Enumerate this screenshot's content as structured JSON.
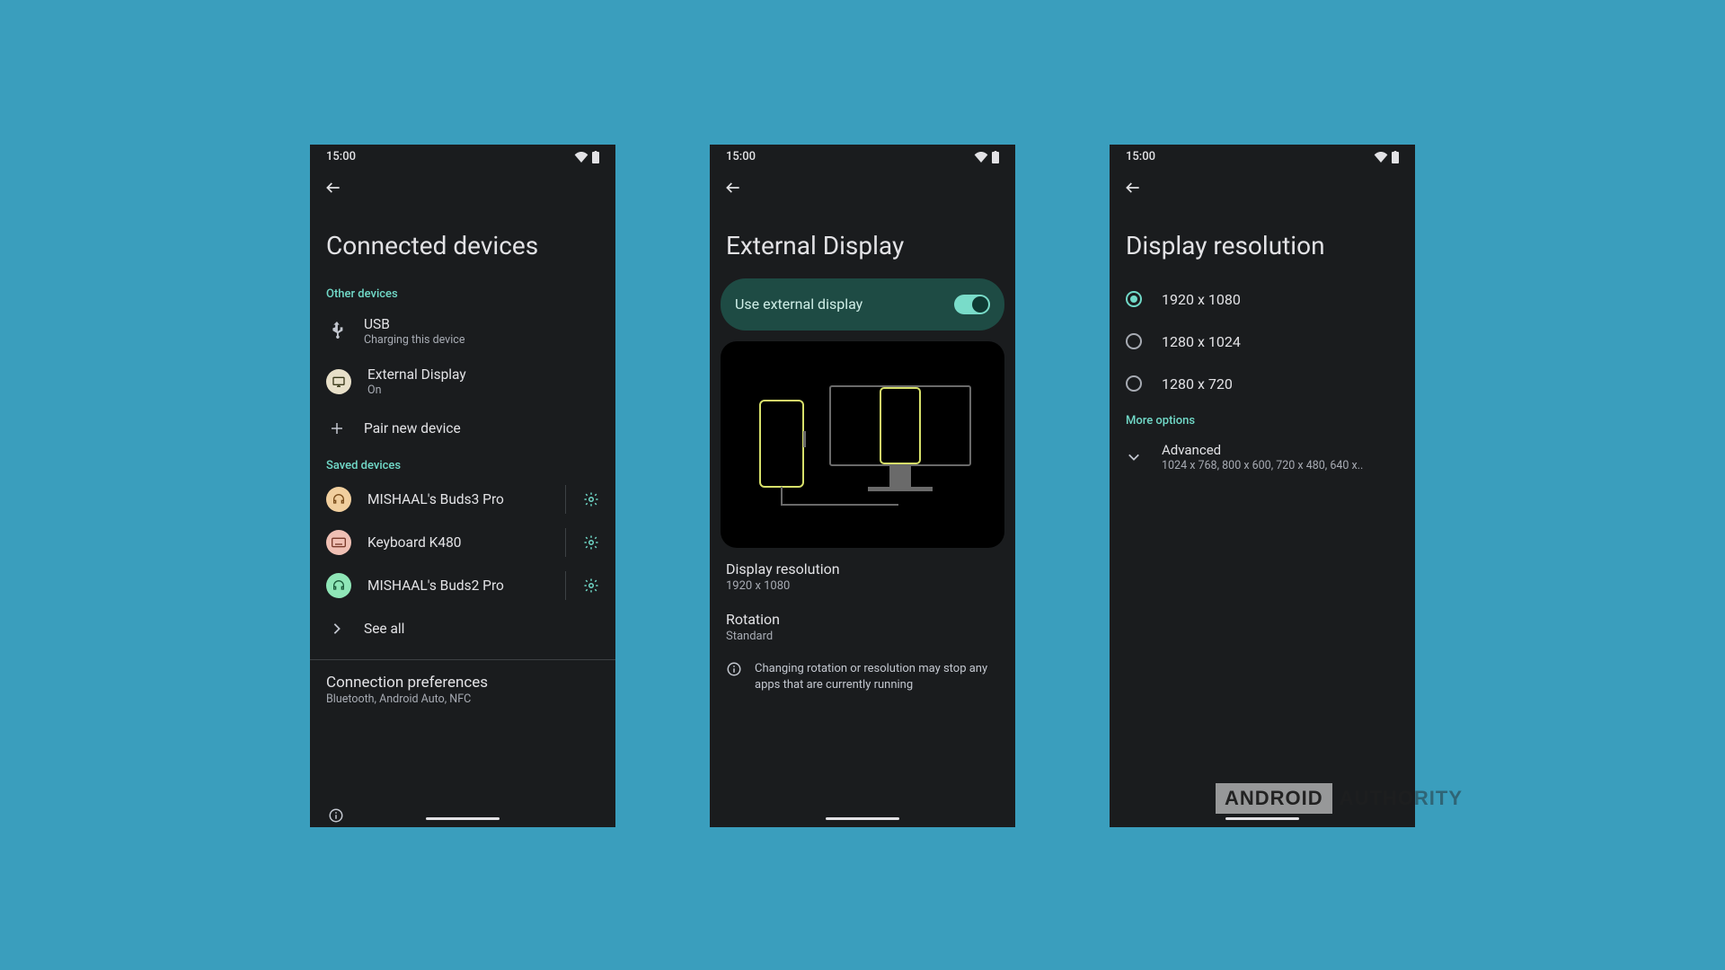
{
  "status": {
    "time": "15:00"
  },
  "screen1": {
    "title": "Connected devices",
    "section_other": "Other devices",
    "usb": {
      "title": "USB",
      "sub": "Charging this device"
    },
    "external": {
      "title": "External Display",
      "sub": "On"
    },
    "pair": "Pair new device",
    "section_saved": "Saved devices",
    "saved": [
      {
        "name": "MISHAAL's Buds3 Pro"
      },
      {
        "name": "Keyboard K480"
      },
      {
        "name": "MISHAAL's Buds2 Pro"
      }
    ],
    "see_all": "See all",
    "con_pref": {
      "title": "Connection preferences",
      "sub": "Bluetooth, Android Auto, NFC"
    }
  },
  "screen2": {
    "title": "External Display",
    "toggle_label": "Use external display",
    "toggle_on": true,
    "resolution": {
      "title": "Display resolution",
      "value": "1920 x 1080"
    },
    "rotation": {
      "title": "Rotation",
      "value": "Standard"
    },
    "info": "Changing rotation or resolution may stop any apps that are currently running"
  },
  "screen3": {
    "title": "Display resolution",
    "options": [
      {
        "label": "1920 x 1080",
        "selected": true
      },
      {
        "label": "1280 x 1024",
        "selected": false
      },
      {
        "label": "1280 x 720",
        "selected": false
      }
    ],
    "more_options": "More options",
    "advanced": {
      "title": "Advanced",
      "sub": "1024 x 768, 800 x 600, 720 x 480, 640 x.."
    }
  },
  "watermark": {
    "box": "ANDROID",
    "plain": "AUTHORITY"
  }
}
